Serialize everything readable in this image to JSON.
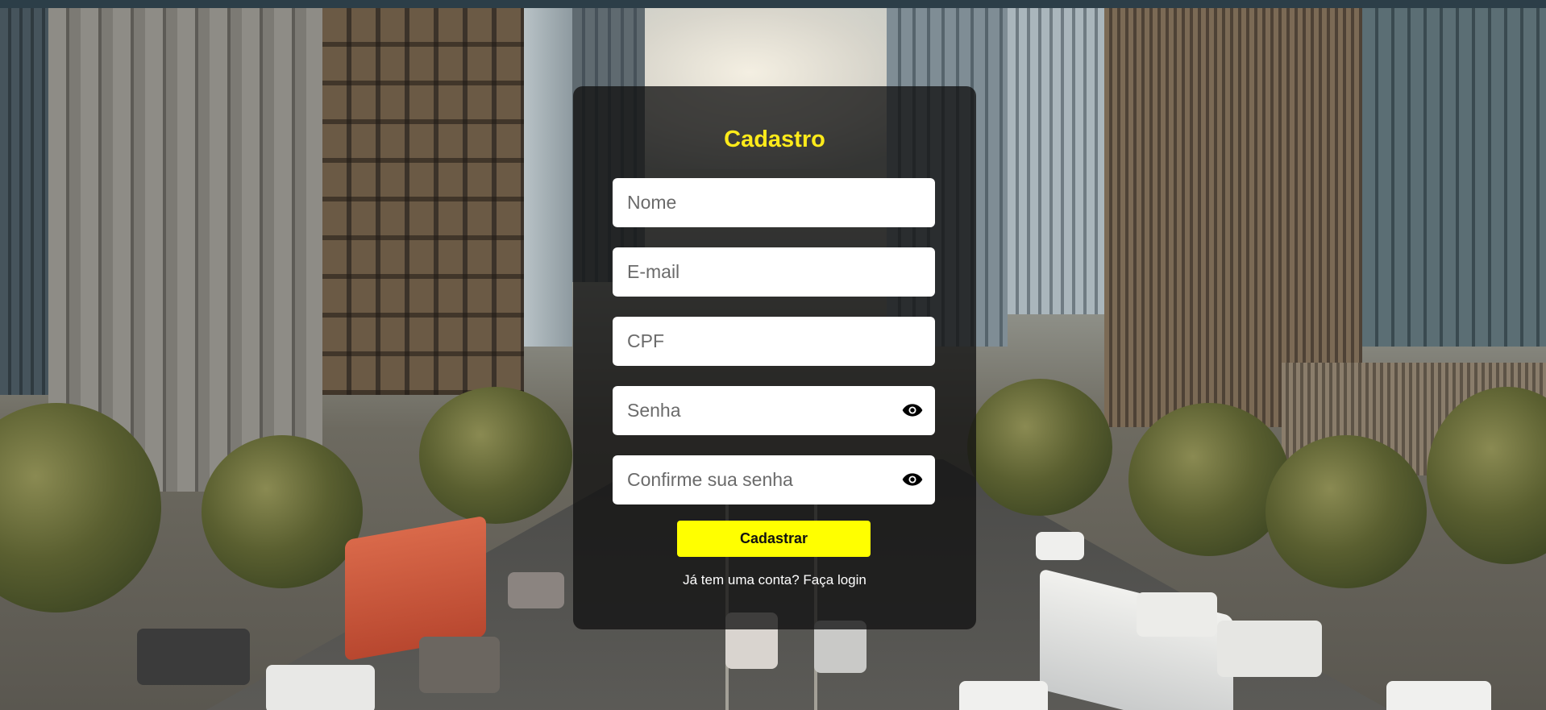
{
  "form": {
    "title": "Cadastro",
    "fields": [
      {
        "placeholder": "Nome",
        "value": ""
      },
      {
        "placeholder": "E-mail",
        "value": ""
      },
      {
        "placeholder": "CPF",
        "value": ""
      },
      {
        "placeholder": "Senha",
        "value": "",
        "icon": "eye-icon"
      },
      {
        "placeholder": "Confirme sua senha",
        "value": "",
        "icon": "eye-icon"
      }
    ],
    "submit_label": "Cadastrar",
    "login_link": "Já tem uma conta? Faça login"
  },
  "colors": {
    "accent": "#ffff00",
    "title": "#ffeb1a",
    "panel": "rgba(18,18,18,0.78)"
  },
  "background": {
    "icon": "city-street-photo"
  }
}
